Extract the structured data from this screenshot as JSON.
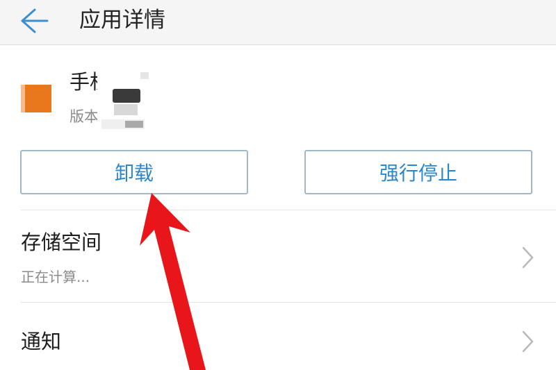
{
  "header": {
    "title": "应用详情"
  },
  "app": {
    "name_partial": "手机",
    "version_partial": "版本"
  },
  "buttons": {
    "uninstall": "卸载",
    "force_stop": "强行停止"
  },
  "rows": [
    {
      "title": "存储空间",
      "subtitle": "正在计算..."
    },
    {
      "title": "通知"
    }
  ],
  "colors": {
    "accent": "#2d86c8",
    "arrow": "#e8161a",
    "app_icon": "#e9781c"
  }
}
